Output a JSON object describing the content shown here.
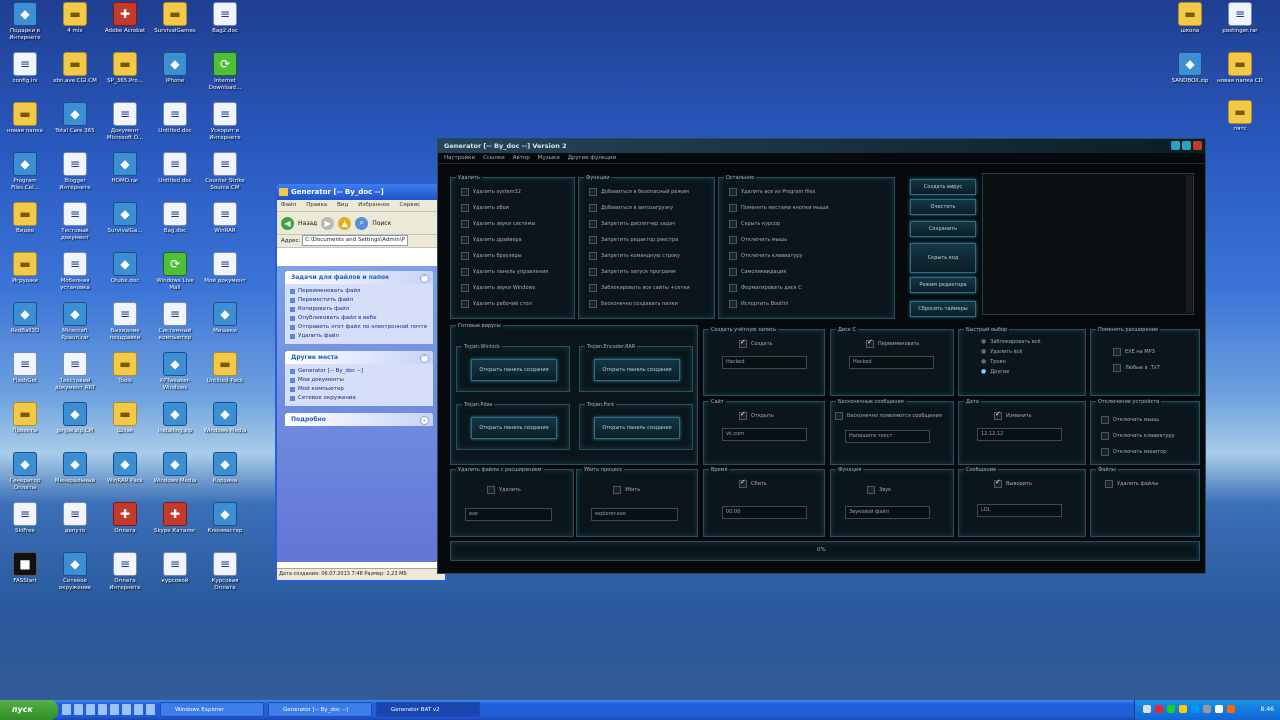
{
  "desktop": {
    "icons_left": [
      {
        "label": "Подарки в Интернете",
        "type": "app"
      },
      {
        "label": "4 mix",
        "type": "folder"
      },
      {
        "label": "Adobe Acrobat",
        "type": "red"
      },
      {
        "label": "SurvivalGames",
        "type": "folder"
      },
      {
        "label": "Bag2.doc",
        "type": "doc"
      },
      {
        "label": "config.ini",
        "type": "doc"
      },
      {
        "label": "xbn.ave.CGI.CM",
        "type": "folder"
      },
      {
        "label": "SP_365.Pro...",
        "type": "folder"
      },
      {
        "label": "iPhone",
        "type": "app"
      },
      {
        "label": "Internet Download...",
        "type": "green"
      },
      {
        "label": "новая папка",
        "type": "folder"
      },
      {
        "label": "Total Care 365",
        "type": "app"
      },
      {
        "label": "Документ Microsoft O...",
        "type": "doc"
      },
      {
        "label": "Untitled.doc",
        "type": "doc"
      },
      {
        "label": "Ускорит в Интернете",
        "type": "doc"
      },
      {
        "label": "Program Files.Cel...",
        "type": "app"
      },
      {
        "label": "Blogger Интернете",
        "type": "doc"
      },
      {
        "label": "HOMO.rar",
        "type": "app"
      },
      {
        "label": "Untitled.doc",
        "type": "doc"
      },
      {
        "label": "Counter Strike Source.CM",
        "type": "doc"
      },
      {
        "label": "Видео",
        "type": "folder"
      },
      {
        "label": "Тестовый документ",
        "type": "doc"
      },
      {
        "label": "SurvivalGa...",
        "type": "app"
      },
      {
        "label": "Bag.doc",
        "type": "doc"
      },
      {
        "label": "WinRAR",
        "type": "doc"
      },
      {
        "label": "Игрушки",
        "type": "folder"
      },
      {
        "label": "Мобилная установка",
        "type": "doc"
      },
      {
        "label": "Qtube.doc",
        "type": "app"
      },
      {
        "label": "Windows Live Mail",
        "type": "green"
      },
      {
        "label": "Мой документ",
        "type": "doc"
      },
      {
        "label": "RedBall3D",
        "type": "app"
      },
      {
        "label": "Minecraft Rpaun.rar",
        "type": "app"
      },
      {
        "label": "Выхидние поздравки",
        "type": "doc"
      },
      {
        "label": "Системный компьютер",
        "type": "doc"
      },
      {
        "label": "Мишеки",
        "type": "app"
      },
      {
        "label": "FlashGet",
        "type": "doc"
      },
      {
        "label": "Текстовый документ ART",
        "type": "doc"
      },
      {
        "label": "Tools",
        "type": "folder"
      },
      {
        "label": "XPTweaker-Windows",
        "type": "app"
      },
      {
        "label": "Untitled-Pack",
        "type": "folder"
      },
      {
        "label": "Проекты",
        "type": "folder"
      },
      {
        "label": "jpnJoe.zip.CM",
        "type": "app"
      },
      {
        "label": "Шлак",
        "type": "folder"
      },
      {
        "label": "Installing.zip",
        "type": "app"
      },
      {
        "label": "Windows Media",
        "type": "app"
      },
      {
        "label": "Генератор Оплаты",
        "type": "app"
      },
      {
        "label": "Минеральный",
        "type": "app"
      },
      {
        "label": "WinRAR Pack",
        "type": "app"
      },
      {
        "label": "Windows Media",
        "type": "app"
      },
      {
        "label": "Корзина",
        "type": "app"
      },
      {
        "label": "SkiFree",
        "type": "doc"
      },
      {
        "label": "депуто",
        "type": "doc"
      },
      {
        "label": "Оплата",
        "type": "red"
      },
      {
        "label": "Skype Каталог",
        "type": "red"
      },
      {
        "label": "Клонмастер",
        "type": "app"
      },
      {
        "label": "FASStart",
        "type": "dark"
      },
      {
        "label": "Сетевое окружение",
        "type": "app"
      },
      {
        "label": "Оплата Интернете",
        "type": "doc"
      },
      {
        "label": "курсовой",
        "type": "doc"
      },
      {
        "label": "Курсовая Оплата",
        "type": "doc"
      }
    ],
    "icons_right": [
      {
        "label": "школа",
        "type": "folder"
      },
      {
        "label": "postinger.rar",
        "type": "doc"
      },
      {
        "label": "SANDBOX.zip",
        "type": "app"
      },
      {
        "label": "новая папка CD",
        "type": "folder"
      },
      {
        "label": "пятс",
        "type": "folder"
      }
    ]
  },
  "explorer": {
    "title": "Generator [-- By_doc --]",
    "menu": [
      "Файл",
      "Правка",
      "Вид",
      "Избранное",
      "Сервис"
    ],
    "back_label": "Назад",
    "search_label": "Поиск",
    "address_label": "Адрес:",
    "address_value": "C:\\Documents and Settings\\Admin\\Р",
    "tasks_title": "Задачи для файлов и папок",
    "tasks": [
      "Переименовать файл",
      "Переместить файл",
      "Копировать файл",
      "Опубликовать файл в вебе",
      "Отправить этот файл по электронной почте",
      "Удалить файл"
    ],
    "places_title": "Другие места",
    "places": [
      "Generator [-- By_doc --]",
      "Мои документы",
      "Мой компьютер",
      "Сетевое окружение"
    ],
    "details_title": "Подробно",
    "status": "Дата создания: 06.07.2013 7:48 Размер: 2,23 МБ"
  },
  "generator": {
    "title": "Generator [-- By_doc --] Version 2",
    "menu": [
      "Настройки",
      "Ссылки",
      "Автор",
      "Музыка",
      "Другие функции"
    ],
    "delete_box": {
      "caption": "Удалить",
      "items": [
        "Удалить system32",
        "Удалить обои",
        "Удалить звуки системы",
        "Удалить драйвера",
        "Удалить браузеры",
        "Удалить панель управления",
        "Удалить звуки Windows",
        "Удалить рабочий стол"
      ]
    },
    "functions_box": {
      "caption": "Функции",
      "items": [
        "Добавиться в безопасный режим",
        "Добавиться в автозагрузку",
        "Запретить диспетчер задач",
        "Запретить редактор реестра",
        "Запретить командную строку",
        "Запретить запуск программ",
        "Заблокировать все сайты +сетки",
        "Бесконечно создавать папки"
      ]
    },
    "other_box": {
      "caption": "Остальное",
      "items": [
        "Удалить все из Program files",
        "Поменять местами кнопки мыши",
        "Скрыть курсор",
        "Отключить мышь",
        "Отключить клавиатуру",
        "Самоликвидация",
        "Форматировать диск C",
        "Испортить BootIni"
      ]
    },
    "buttons": [
      "Создать вирус",
      "Очистить",
      "Сохранить",
      "Скрыть код",
      "Режим редактора",
      "Сбросить таймеры"
    ],
    "ready_box": {
      "caption": "Готовые вирусы",
      "items": [
        {
          "caption": "Trojan.Winlock",
          "button": "Открыть панель создания"
        },
        {
          "caption": "Trojan.Encoder.RAR",
          "button": "Открыть панель создания"
        },
        {
          "caption": "Trojan.Pdas",
          "button": "Открыть панель создания"
        },
        {
          "caption": "Trojan.Fork",
          "button": "Открыть панель создания"
        }
      ]
    },
    "create_acc": {
      "caption": "Создать учётную запись",
      "check": "Создать",
      "value": "Hacked"
    },
    "disk_c": {
      "caption": "Диск C",
      "check": "Переименовать",
      "value": "Hacked"
    },
    "quick": {
      "caption": "Быстрый выбор",
      "items": [
        "Заблокировать всё",
        "Удалить всё",
        "Троян",
        "Другие"
      ]
    },
    "ext": {
      "caption": "Поменять расширение",
      "items": [
        "EXE на MP3",
        "Любые в .TxT"
      ]
    },
    "site": {
      "caption": "Сайт",
      "check": "Открыть",
      "value": "vk.com"
    },
    "msg_inf": {
      "caption": "Бесконечные сообщения",
      "check": "Бесконечно появляются сообщения",
      "value": "Напишите текст"
    },
    "date": {
      "caption": "Дата",
      "check": "Изменить",
      "value": "12.12.12"
    },
    "devices": {
      "caption": "Отключение устройств",
      "items": [
        "Отключить мышь",
        "Отключить клавиатуру",
        "Отключить монитор"
      ]
    },
    "del_ext": {
      "caption": "Удалить файлы с расширением",
      "check": "Удалить",
      "value": "exe"
    },
    "kill": {
      "caption": "Убить процесс",
      "check": "Убить",
      "value": "explorer.exe"
    },
    "time": {
      "caption": "Время",
      "check": "Сбить",
      "value": "00:00"
    },
    "func2": {
      "caption": "Функция",
      "check": "Звук",
      "value": "Звуковой файл"
    },
    "msg": {
      "caption": "Сообщение",
      "check": "Выводить",
      "value": "LOL"
    },
    "files": {
      "caption": "Файлы",
      "check": "Удалить файлы"
    },
    "progress": "0%"
  },
  "taskbar": {
    "start": "пуск",
    "tasks": [
      "Windows Explorer",
      "Generator [-- By_doc --]",
      "Generator BAT v2"
    ],
    "clock": "8:46"
  }
}
